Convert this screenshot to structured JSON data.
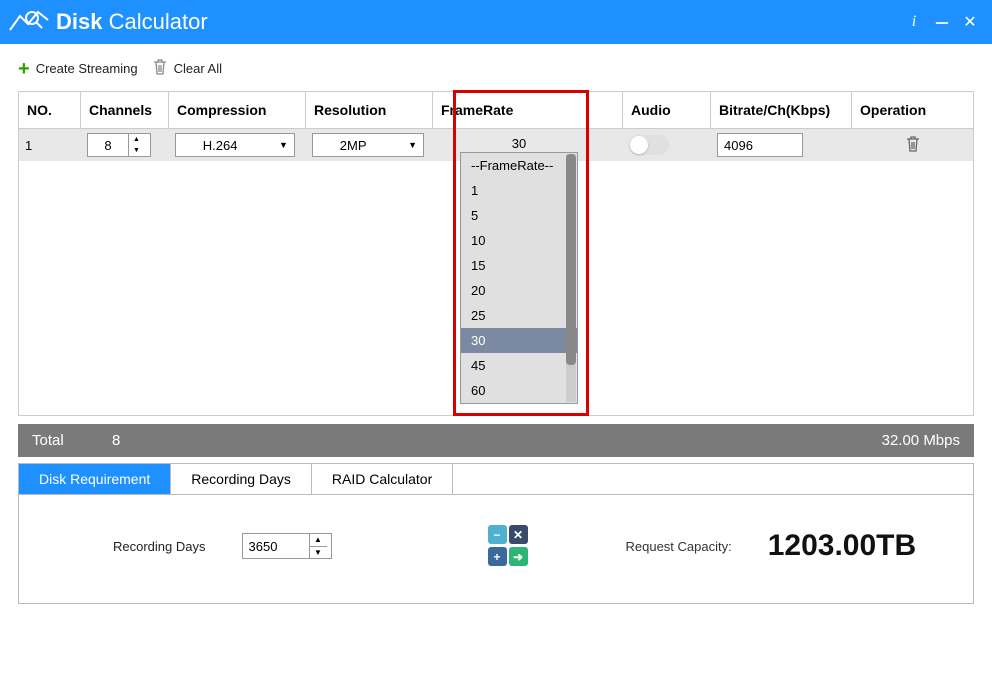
{
  "app": {
    "title_bold": "Disk",
    "title_light": " Calculator"
  },
  "toolbar": {
    "create": "Create Streaming",
    "clear": "Clear All"
  },
  "columns": {
    "no": "NO.",
    "channels": "Channels",
    "compression": "Compression",
    "resolution": "Resolution",
    "framerate": "FrameRate",
    "audio": "Audio",
    "bitrate": "Bitrate/Ch(Kbps)",
    "operation": "Operation"
  },
  "row": {
    "no": "1",
    "channels": "8",
    "compression": "H.264",
    "resolution": "2MP",
    "framerate_sel": "30",
    "bitrate": "4096"
  },
  "fr_options": [
    "--FrameRate--",
    "1",
    "5",
    "10",
    "15",
    "20",
    "25",
    "30",
    "45",
    "60"
  ],
  "total": {
    "label": "Total",
    "channels": "8",
    "mbps": "32.00 Mbps"
  },
  "tabs": {
    "t1": "Disk Requirement",
    "t2": "Recording Days",
    "t3": "RAID Calculator"
  },
  "requirement": {
    "rd_label": "Recording Days",
    "rd_value": "3650",
    "req_label": "Request Capacity:",
    "req_value": "1203.00TB"
  }
}
